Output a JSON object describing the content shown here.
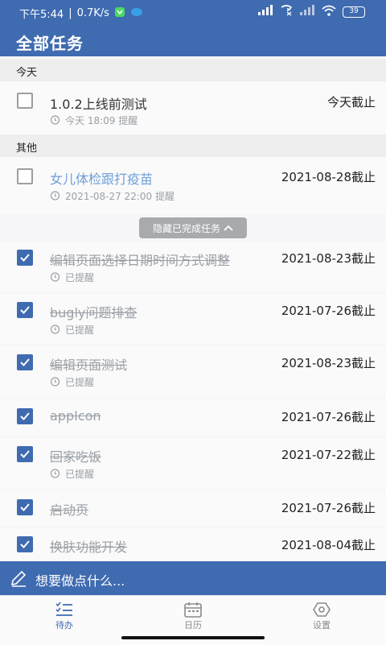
{
  "status_bar": {
    "time": "下午5:44",
    "separator": "|",
    "speed": "0.7K/s",
    "battery": "39"
  },
  "app_bar": {
    "title": "全部任务"
  },
  "sections": {
    "today": "今天",
    "other": "其他"
  },
  "tasks": [
    {
      "title": "1.0.2上线前测试",
      "due": "今天截止",
      "reminder": "今天 18:09 提醒",
      "checked": false
    },
    {
      "title": "女儿体检跟打疫苗",
      "due": "2021-08-28截止",
      "reminder": "2021-08-27 22:00 提醒",
      "checked": false
    },
    {
      "title": "编辑页面选择日期时间方式调整",
      "due": "2021-08-23截止",
      "reminder": "已提醒",
      "checked": true
    },
    {
      "title": "bugly问题排查",
      "due": "2021-07-26截止",
      "reminder": "已提醒",
      "checked": true
    },
    {
      "title": "编辑页面测试",
      "due": "2021-08-23截止",
      "reminder": "已提醒",
      "checked": true
    },
    {
      "title": "appIcon",
      "due": "2021-07-26截止",
      "reminder": "",
      "checked": true
    },
    {
      "title": "回家吃饭",
      "due": "2021-07-22截止",
      "reminder": "已提醒",
      "checked": true
    },
    {
      "title": "启动页",
      "due": "2021-07-26截止",
      "reminder": "",
      "checked": true
    },
    {
      "title": "换肤功能开发",
      "due": "2021-08-04截止",
      "reminder": "",
      "checked": true
    }
  ],
  "toggle_completed": {
    "label": "隐藏已完成任务"
  },
  "composer": {
    "placeholder": "想要做点什么..."
  },
  "bottom_nav": {
    "todo": "待办",
    "calendar": "日历",
    "settings": "设置"
  },
  "colors": {
    "accent": "#3f6bb0"
  }
}
